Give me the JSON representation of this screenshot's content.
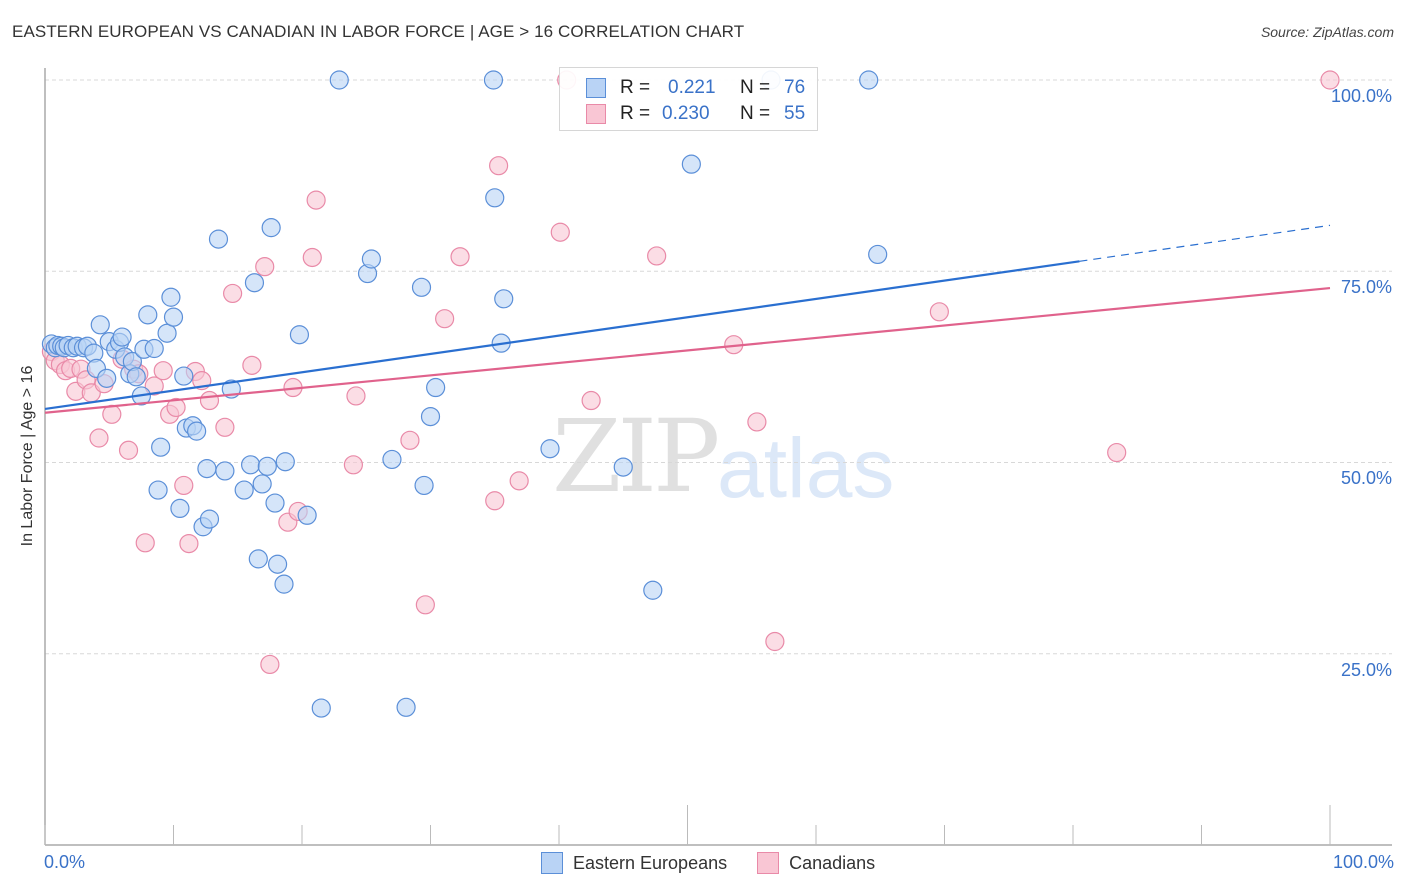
{
  "title": "EASTERN EUROPEAN VS CANADIAN IN LABOR FORCE | AGE > 16 CORRELATION CHART",
  "source": "Source: ZipAtlas.com",
  "watermark": {
    "zip": "ZIP",
    "atlas": "atlas"
  },
  "colors": {
    "blue_fill": "#b9d3f5",
    "blue_stroke": "#5b8fd8",
    "blue_line": "#2a6fd0",
    "pink_fill": "#f9c6d4",
    "pink_stroke": "#e98aa8",
    "pink_line": "#e0628c",
    "tick_text": "#3a72c8",
    "grid": "#d8d8d8"
  },
  "legend_stats": [
    {
      "series": "Eastern Europeans",
      "r_label": "R =",
      "r_value": "0.221",
      "n_label": "N =",
      "n_value": "76"
    },
    {
      "series": "Canadians",
      "r_label": "R =",
      "r_value": "0.230",
      "n_label": "N =",
      "n_value": "55"
    }
  ],
  "chart_data": {
    "type": "scatter",
    "title": "EASTERN EUROPEAN VS CANADIAN IN LABOR FORCE | AGE > 16 CORRELATION CHART",
    "xlabel": "",
    "ylabel": "In Labor Force | Age > 16",
    "xlim": [
      0,
      100
    ],
    "ylim": [
      0,
      100
    ],
    "x_tick_labels": [
      "0.0%",
      "100.0%"
    ],
    "y_ticks": [
      25,
      50,
      75,
      100
    ],
    "y_tick_labels": [
      "25.0%",
      "50.0%",
      "75.0%",
      "100.0%"
    ],
    "grid": true,
    "legend_position": "bottom",
    "series": [
      {
        "name": "Eastern Europeans",
        "r": 0.221,
        "n": 76,
        "trend": {
          "x0": 0,
          "y0": 57.0,
          "x1": 80.5,
          "y1": 76.3,
          "dashed_to_x": 100,
          "dashed_to_y": 81.0
        },
        "points": [
          [
            0.5,
            65.5
          ],
          [
            0.8,
            65.0
          ],
          [
            1.0,
            65.3
          ],
          [
            1.3,
            65.2
          ],
          [
            1.5,
            65.0
          ],
          [
            1.8,
            65.3
          ],
          [
            2.2,
            65.0
          ],
          [
            2.5,
            65.2
          ],
          [
            3.0,
            65.0
          ],
          [
            3.3,
            65.2
          ],
          [
            3.8,
            64.3
          ],
          [
            4.0,
            62.3
          ],
          [
            4.3,
            68.0
          ],
          [
            4.8,
            61.0
          ],
          [
            5.0,
            65.8
          ],
          [
            5.5,
            64.8
          ],
          [
            5.8,
            65.7
          ],
          [
            6.0,
            66.4
          ],
          [
            6.2,
            63.8
          ],
          [
            6.6,
            61.6
          ],
          [
            6.8,
            63.2
          ],
          [
            7.1,
            61.2
          ],
          [
            7.5,
            58.7
          ],
          [
            7.7,
            64.8
          ],
          [
            8.0,
            69.3
          ],
          [
            8.5,
            64.9
          ],
          [
            9.0,
            52.0
          ],
          [
            9.5,
            66.9
          ],
          [
            9.8,
            71.6
          ],
          [
            10.0,
            69.0
          ],
          [
            8.8,
            46.4
          ],
          [
            10.5,
            44.0
          ],
          [
            10.8,
            61.3
          ],
          [
            11.0,
            54.5
          ],
          [
            11.5,
            54.8
          ],
          [
            11.8,
            54.1
          ],
          [
            12.3,
            41.6
          ],
          [
            12.6,
            49.2
          ],
          [
            12.8,
            42.6
          ],
          [
            13.5,
            79.2
          ],
          [
            14.0,
            48.9
          ],
          [
            14.5,
            59.6
          ],
          [
            15.5,
            46.4
          ],
          [
            16.0,
            49.7
          ],
          [
            16.3,
            73.5
          ],
          [
            16.6,
            37.4
          ],
          [
            16.9,
            47.2
          ],
          [
            17.3,
            49.5
          ],
          [
            17.6,
            80.7
          ],
          [
            17.9,
            44.7
          ],
          [
            18.1,
            36.7
          ],
          [
            18.6,
            34.1
          ],
          [
            18.7,
            50.1
          ],
          [
            19.8,
            66.7
          ],
          [
            20.4,
            43.1
          ],
          [
            21.5,
            17.9
          ],
          [
            22.9,
            100.0
          ],
          [
            25.1,
            74.7
          ],
          [
            25.4,
            76.6
          ],
          [
            27.0,
            50.4
          ],
          [
            28.1,
            18.0
          ],
          [
            29.3,
            72.9
          ],
          [
            30.0,
            56.0
          ],
          [
            30.4,
            59.8
          ],
          [
            34.9,
            100.0
          ],
          [
            35.0,
            84.6
          ],
          [
            35.5,
            65.6
          ],
          [
            35.7,
            71.4
          ],
          [
            39.3,
            51.8
          ],
          [
            45.0,
            49.4
          ],
          [
            47.3,
            33.3
          ],
          [
            50.3,
            89.0
          ],
          [
            56.5,
            100.0
          ],
          [
            64.1,
            100.0
          ],
          [
            64.8,
            77.2
          ],
          [
            29.5,
            47.0
          ]
        ]
      },
      {
        "name": "Canadians",
        "r": 0.23,
        "n": 55,
        "trend": {
          "x0": 0,
          "y0": 56.5,
          "x1": 100,
          "y1": 72.8
        },
        "points": [
          [
            0.5,
            64.5
          ],
          [
            0.8,
            63.3
          ],
          [
            1.2,
            62.8
          ],
          [
            1.6,
            62.0
          ],
          [
            2.0,
            62.3
          ],
          [
            2.4,
            59.3
          ],
          [
            2.8,
            62.2
          ],
          [
            3.2,
            60.8
          ],
          [
            3.6,
            59.1
          ],
          [
            4.2,
            53.2
          ],
          [
            4.6,
            60.3
          ],
          [
            5.2,
            56.3
          ],
          [
            6.0,
            63.5
          ],
          [
            6.5,
            51.6
          ],
          [
            6.9,
            62.2
          ],
          [
            7.3,
            61.6
          ],
          [
            7.8,
            39.5
          ],
          [
            8.5,
            60.0
          ],
          [
            9.2,
            62.0
          ],
          [
            9.7,
            56.3
          ],
          [
            10.2,
            57.2
          ],
          [
            10.8,
            47.0
          ],
          [
            11.2,
            39.4
          ],
          [
            11.7,
            61.9
          ],
          [
            12.2,
            60.7
          ],
          [
            12.8,
            58.1
          ],
          [
            14.0,
            54.6
          ],
          [
            14.6,
            72.1
          ],
          [
            16.1,
            62.7
          ],
          [
            17.1,
            75.6
          ],
          [
            17.5,
            23.6
          ],
          [
            18.9,
            42.2
          ],
          [
            19.3,
            59.8
          ],
          [
            19.7,
            43.6
          ],
          [
            20.8,
            76.8
          ],
          [
            21.1,
            84.3
          ],
          [
            24.0,
            49.7
          ],
          [
            24.2,
            58.7
          ],
          [
            28.4,
            52.9
          ],
          [
            29.6,
            31.4
          ],
          [
            31.1,
            68.8
          ],
          [
            32.3,
            76.9
          ],
          [
            35.0,
            45.0
          ],
          [
            35.3,
            88.8
          ],
          [
            36.9,
            47.6
          ],
          [
            40.1,
            80.1
          ],
          [
            40.6,
            100.0
          ],
          [
            42.5,
            58.1
          ],
          [
            47.6,
            77.0
          ],
          [
            53.6,
            65.4
          ],
          [
            55.4,
            55.3
          ],
          [
            56.8,
            26.6
          ],
          [
            69.6,
            69.7
          ],
          [
            83.4,
            51.3
          ],
          [
            100.0,
            100.0
          ]
        ]
      }
    ]
  }
}
